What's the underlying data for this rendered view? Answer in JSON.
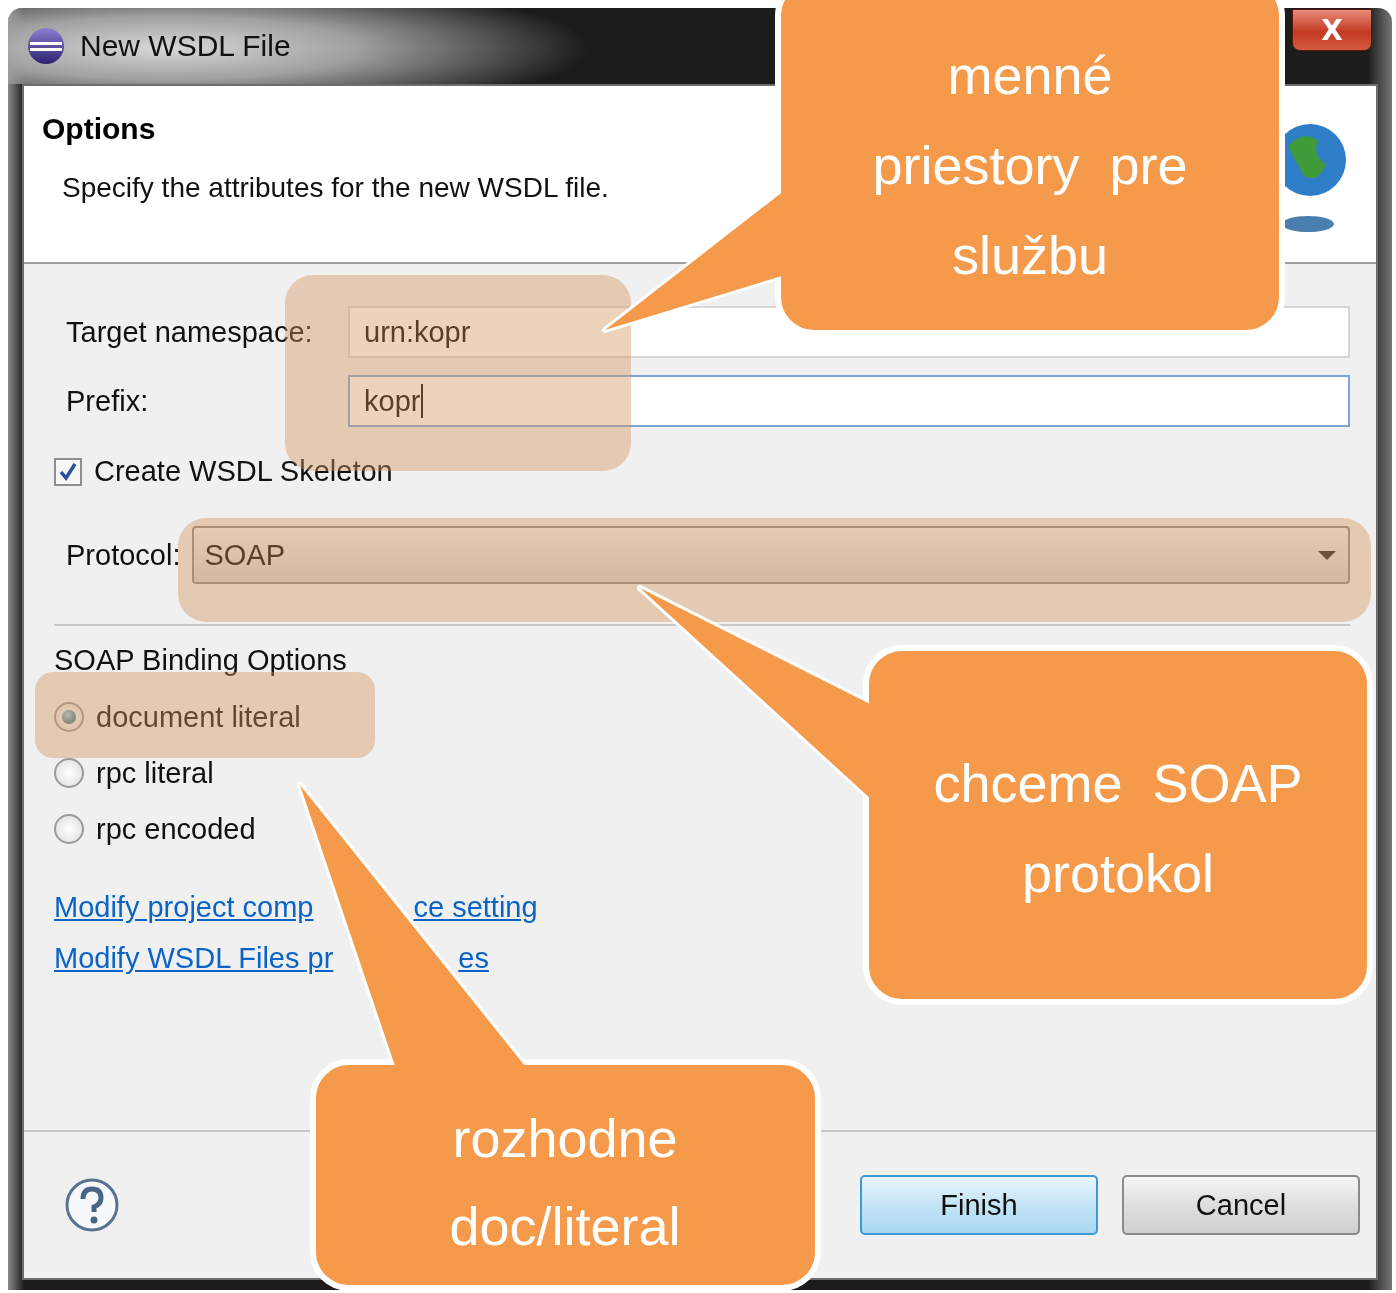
{
  "window": {
    "title": "New WSDL File",
    "close_label": "X"
  },
  "header": {
    "title": "Options",
    "description": "Specify the attributes for the new WSDL file."
  },
  "fields": [
    {
      "label": "Target namespace:",
      "value": "urn:kopr",
      "focused": false
    },
    {
      "label": "Prefix:",
      "value": "kopr",
      "focused": true
    }
  ],
  "checkbox": {
    "label": "Create WSDL Skeleton",
    "checked": true
  },
  "protocol": {
    "label": "Protocol:",
    "value": "SOAP"
  },
  "binding": {
    "title": "SOAP Binding Options",
    "options": [
      {
        "label": "document literal",
        "selected": true
      },
      {
        "label": "rpc literal",
        "selected": false
      },
      {
        "label": "rpc encoded",
        "selected": false
      }
    ]
  },
  "links": [
    {
      "parts": [
        "Modify project comp",
        "ce setting"
      ]
    },
    {
      "parts": [
        "Modify WSDL Files pr",
        "es"
      ]
    }
  ],
  "buttons": [
    {
      "label": "Finish",
      "default": true
    },
    {
      "label": "Cancel",
      "default": false
    }
  ],
  "callouts": [
    {
      "text": "menné\npriestory  pre\nslužbu"
    },
    {
      "text": "chceme  SOAP\nprotokol"
    },
    {
      "text": "rozhodne\ndoc/literal"
    }
  ]
}
